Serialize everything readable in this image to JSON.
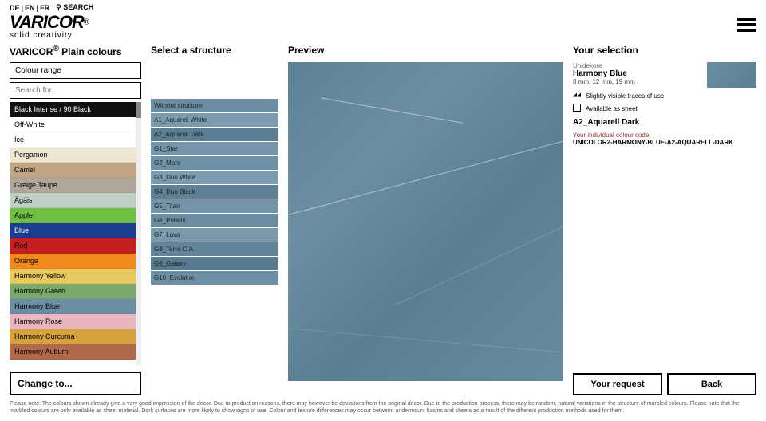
{
  "languages": [
    "DE",
    "EN",
    "FR"
  ],
  "search_label": "SEARCH",
  "logo": {
    "brand": "VARICOR",
    "reg": "®",
    "tagline": "solid creativity"
  },
  "columns": {
    "colours_title_prefix": "VARICOR",
    "colours_title_suffix": " Plain colours",
    "structure_title": "Select a structure",
    "preview_title": "Preview",
    "selection_title": "Your selection"
  },
  "colour_range_label": "Colour range",
  "search_placeholder": "Search for...",
  "colours": [
    {
      "label": "Black Intense / 90 Black",
      "bg": "#111111",
      "fg": "#ffffff"
    },
    {
      "label": "Off-White",
      "bg": "#ffffff",
      "fg": "#000000"
    },
    {
      "label": "Ice",
      "bg": "#ffffff",
      "fg": "#000000"
    },
    {
      "label": "Pergamon",
      "bg": "#eee5d3",
      "fg": "#000000"
    },
    {
      "label": "Camel",
      "bg": "#c2a583",
      "fg": "#000000"
    },
    {
      "label": "Greige Taupe",
      "bg": "#b0a79a",
      "fg": "#000000"
    },
    {
      "label": "Ägäis",
      "bg": "#bfcfc5",
      "fg": "#000000"
    },
    {
      "label": "Apple",
      "bg": "#6fbf44",
      "fg": "#000000"
    },
    {
      "label": "Blue",
      "bg": "#1a3d8f",
      "fg": "#ffffff"
    },
    {
      "label": "Red",
      "bg": "#c41e1e",
      "fg": "#000000"
    },
    {
      "label": "Orange",
      "bg": "#f08a1d",
      "fg": "#000000"
    },
    {
      "label": "Harmony Yellow",
      "bg": "#e7c960",
      "fg": "#000000"
    },
    {
      "label": "Harmony Green",
      "bg": "#7aa96b",
      "fg": "#000000"
    },
    {
      "label": "Harmony Blue",
      "bg": "#6b8ea2",
      "fg": "#000000"
    },
    {
      "label": "Harmony Rose",
      "bg": "#e9b5bf",
      "fg": "#000000"
    },
    {
      "label": "Harmony Curcuma",
      "bg": "#d6a23e",
      "fg": "#000000"
    },
    {
      "label": "Harmony Auburn",
      "bg": "#b06a4a",
      "fg": "#000000"
    }
  ],
  "change_to": "Change to...",
  "structures": [
    {
      "label": "Without structure",
      "bg": "#6b8ea2"
    },
    {
      "label": "A1_Aquarell White",
      "bg": "#7a9bb0"
    },
    {
      "label": "A2_Aquarell Dark",
      "bg": "#5c7e93"
    },
    {
      "label": "G1_Star",
      "bg": "#7596aa"
    },
    {
      "label": "G2_Mare",
      "bg": "#6e91a5"
    },
    {
      "label": "G3_Duo White",
      "bg": "#7b9cb0"
    },
    {
      "label": "G4_Duo Black",
      "bg": "#5f8195"
    },
    {
      "label": "G5_Titan",
      "bg": "#7394a9"
    },
    {
      "label": "G6_Polaris",
      "bg": "#6a8da1"
    },
    {
      "label": "G7_Lava",
      "bg": "#7999ad"
    },
    {
      "label": "G8_Terra C.A.",
      "bg": "#62859a"
    },
    {
      "label": "G9_Galaxy",
      "bg": "#577a8f"
    },
    {
      "label": "G10_Evolution",
      "bg": "#6c8fa4"
    }
  ],
  "selection": {
    "category_label": "Unidekore",
    "name": "Harmony Blue",
    "dims": "8 mm, 12 mm, 19 mm",
    "traces": "Slightly visible traces of use",
    "available_sheet": "Available as sheet",
    "structure": "A2_Aquarell Dark",
    "code_label": "Your individual colour code:",
    "code": "UNICOLOR2-HARMONY-BLUE-A2-AQUARELL-DARK"
  },
  "buttons": {
    "request": "Your request",
    "back": "Back"
  },
  "footnote": "Please note: The colours shown already give a very good impression of the decor. Due to production reasons, there may however be deviations from the original decor. Due to the production process, there may be random, natural variations in the structure of marbled colours. Please note that the marbled colours are only available as sheet material. Dark surfaces are more likely to show signs of use. Colour and texture differences may occur between undermount basins and sheets as a result of the different production methods used for them."
}
